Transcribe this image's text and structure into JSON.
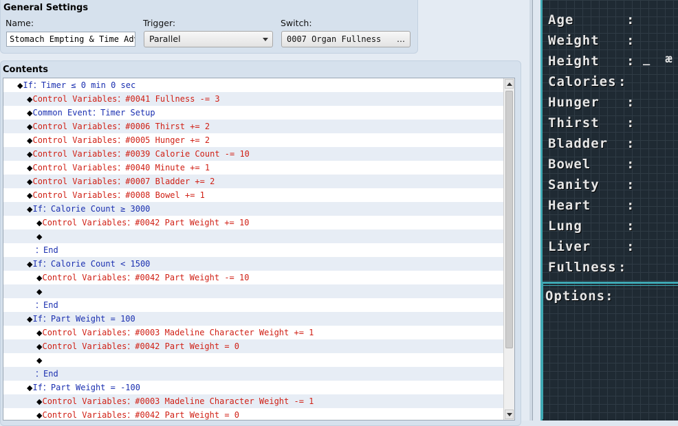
{
  "general_settings": {
    "title": "General Settings",
    "name_label": "Name:",
    "name_value": "Stomach Empting & Time Adva",
    "trigger_label": "Trigger:",
    "trigger_value": "Parallel",
    "switch_label": "Switch:",
    "switch_value": "0007 Organ Fullness",
    "switch_button": "…"
  },
  "contents": {
    "title": "Contents",
    "rows": [
      {
        "indent": 0,
        "kind": "blue",
        "text": "If：Timer ≤ 0 min 0 sec"
      },
      {
        "indent": 1,
        "kind": "red",
        "text": "Control Variables：#0041 Fullness -= 3"
      },
      {
        "indent": 1,
        "kind": "blue",
        "text": "Common Event：Timer Setup"
      },
      {
        "indent": 1,
        "kind": "red",
        "text": "Control Variables：#0006 Thirst += 2"
      },
      {
        "indent": 1,
        "kind": "red",
        "text": "Control Variables：#0005 Hunger += 2"
      },
      {
        "indent": 1,
        "kind": "red",
        "text": "Control Variables：#0039 Calorie Count -= 10"
      },
      {
        "indent": 1,
        "kind": "red",
        "text": "Control Variables：#0040 Minute += 1"
      },
      {
        "indent": 1,
        "kind": "red",
        "text": "Control Variables：#0007 Bladder += 2"
      },
      {
        "indent": 1,
        "kind": "red",
        "text": "Control Variables：#0008 Bowel += 1"
      },
      {
        "indent": 1,
        "kind": "blue",
        "text": "If：Calorie Count ≥ 3000"
      },
      {
        "indent": 2,
        "kind": "red",
        "text": "Control Variables：#0042 Part Weight += 10"
      },
      {
        "indent": 2,
        "kind": "empty",
        "text": ""
      },
      {
        "indent": 1,
        "kind": "end",
        "text": "：End"
      },
      {
        "indent": 1,
        "kind": "blue",
        "text": "If：Calorie Count < 1500"
      },
      {
        "indent": 2,
        "kind": "red",
        "text": "Control Variables：#0042 Part Weight -= 10"
      },
      {
        "indent": 2,
        "kind": "empty",
        "text": ""
      },
      {
        "indent": 1,
        "kind": "end",
        "text": "：End"
      },
      {
        "indent": 1,
        "kind": "blue",
        "text": "If：Part Weight = 100"
      },
      {
        "indent": 2,
        "kind": "red",
        "text": "Control Variables：#0003 Madeline Character Weight += 1"
      },
      {
        "indent": 2,
        "kind": "red",
        "text": "Control Variables：#0042 Part Weight = 0"
      },
      {
        "indent": 2,
        "kind": "empty",
        "text": ""
      },
      {
        "indent": 1,
        "kind": "end",
        "text": "：End"
      },
      {
        "indent": 1,
        "kind": "blue",
        "text": "If：Part Weight = -100"
      },
      {
        "indent": 2,
        "kind": "red",
        "text": "Control Variables：#0003 Madeline Character Weight -= 1"
      },
      {
        "indent": 2,
        "kind": "red",
        "text": "Control Variables：#0042 Part Weight = 0"
      }
    ]
  },
  "game_window": {
    "stats": [
      "Age",
      "Weight",
      "Height",
      "Calories",
      "Hunger",
      "Thirst",
      "Bladder",
      "Bowel",
      "Sanity",
      "Heart",
      "Lung",
      "Liver",
      "Fullness"
    ],
    "colon": ":",
    "height_extra": "_ æ",
    "options_label": "Options:"
  },
  "colors": {
    "command_blue": "#1a2fb0",
    "command_red": "#d01f14",
    "game_border": "#3fa9b4",
    "game_bg": "#1f2a33"
  }
}
